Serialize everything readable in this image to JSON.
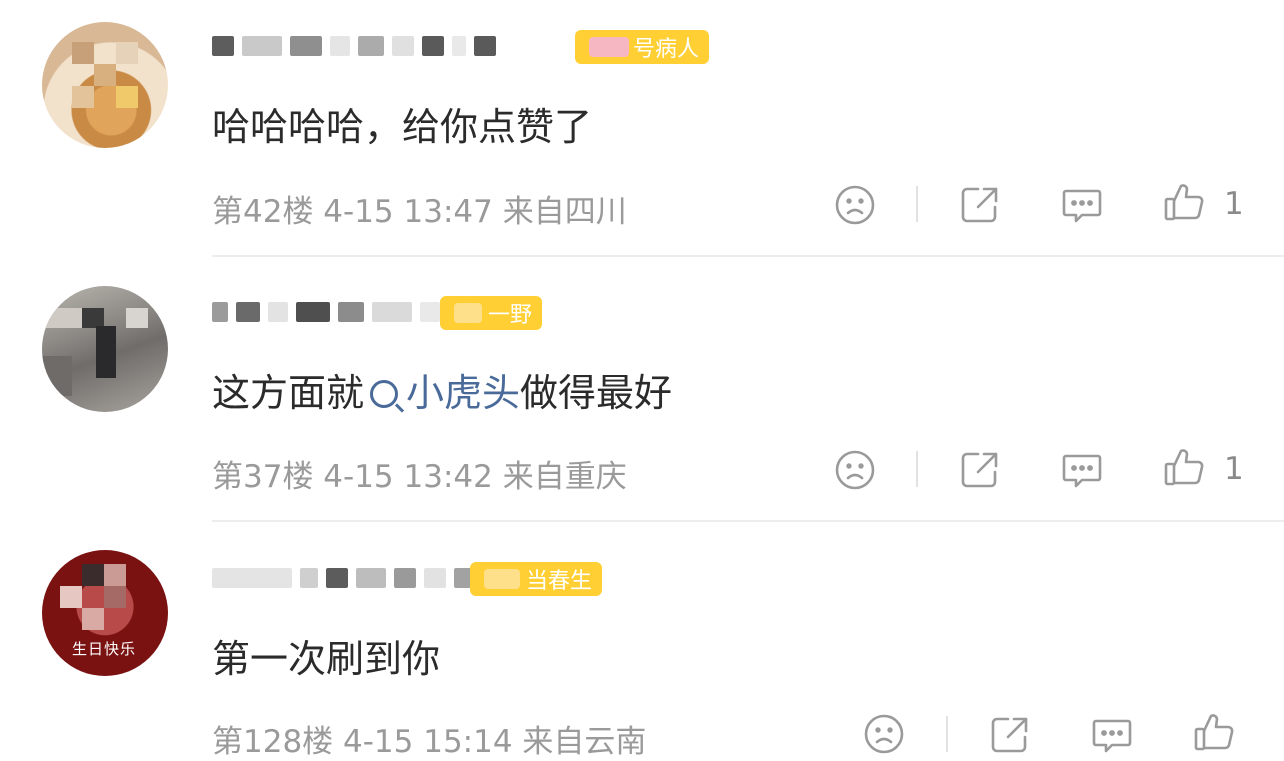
{
  "comments": [
    {
      "badge": "号病人",
      "text": "哈哈哈哈，给你点赞了",
      "meta": "第42楼  4-15 13:47  来自四川",
      "likes": "1"
    },
    {
      "badge": "一野",
      "text_before": "这方面就",
      "link": "小虎头",
      "text_after": "做得最好",
      "meta": "第37楼  4-15 13:42  来自重庆",
      "likes": "1"
    },
    {
      "badge": "当春生",
      "text": "第一次刷到你",
      "meta": "第128楼  4-15 15:14  来自云南",
      "avatar_text": "生日快乐"
    }
  ],
  "icons": [
    "sad-face-icon",
    "share-icon",
    "comment-icon",
    "thumbs-up-icon"
  ],
  "colors": {
    "badge": "#ffcf33",
    "link": "#4a6b9a",
    "meta": "#9a9a9a",
    "text": "#2b2b2b"
  }
}
